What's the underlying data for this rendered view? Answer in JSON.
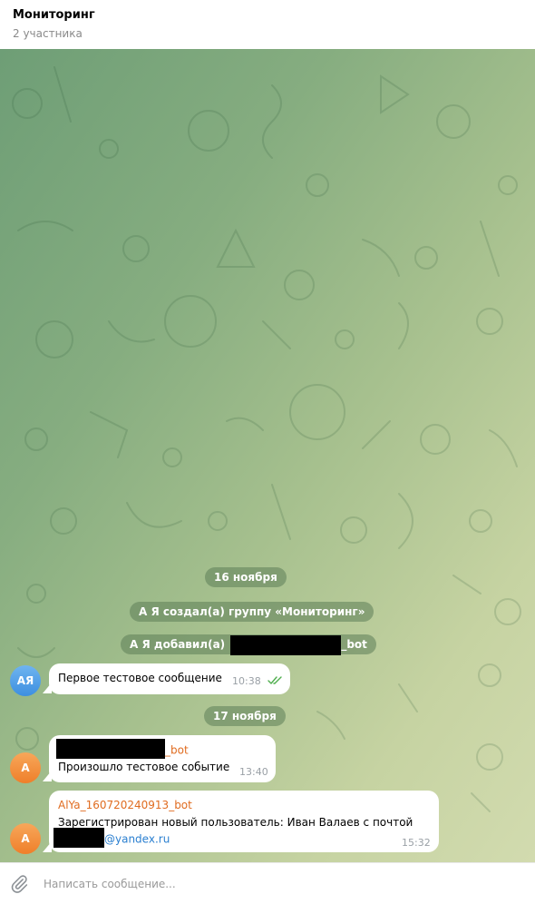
{
  "header": {
    "title": "Мониторинг",
    "subtitle": "2 участника"
  },
  "messages": {
    "date_1": "16 ноября",
    "service_1": "А Я создал(а) группу «Мониторинг»",
    "service_2_prefix": "А Я добавил(а)",
    "service_2_suffix": "_bot",
    "msg1": {
      "avatar": "АЯ",
      "text": "Первое тестовое сообщение",
      "time": "10:38"
    },
    "date_2": "17 ноября",
    "msg2": {
      "avatar": "А",
      "sender_suffix": "_bot",
      "text": "Произошло тестовое событие",
      "time": "13:40"
    },
    "msg3": {
      "avatar": "А",
      "sender": "AlYa_160720240913_bot",
      "text_line1": "Зарегистрирован новый пользователь: Иван Валаев с почтой",
      "email_domain": "@yandex.ru",
      "time": "15:32"
    }
  },
  "composer": {
    "placeholder": "Написать сообщение..."
  },
  "colors": {
    "sender": "#e06c20",
    "link": "#2a7fd0",
    "read_ticks": "#4fae4e",
    "pill_bg": "#5c7e58"
  },
  "icons": {
    "attach": "paperclip-icon",
    "read_status": "double-check-icon"
  }
}
